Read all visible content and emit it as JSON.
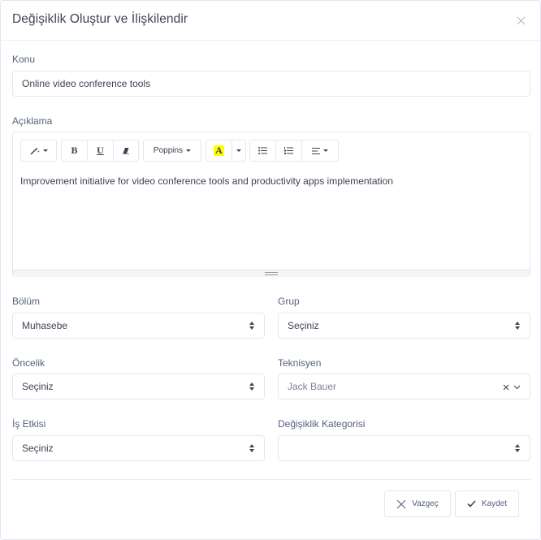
{
  "modal": {
    "title": "Değişiklik Oluştur ve İlişkilendir"
  },
  "fields": {
    "konu": {
      "label": "Konu",
      "value": "Online video conference tools"
    },
    "aciklama": {
      "label": "Açıklama",
      "content": "Improvement initiative for video conference tools and productivity apps implementation"
    },
    "bolum": {
      "label": "Bölüm",
      "value": "Muhasebe"
    },
    "grup": {
      "label": "Grup",
      "value": "Seçiniz"
    },
    "oncelik": {
      "label": "Öncelik",
      "value": "Seçiniz"
    },
    "teknisyen": {
      "label": "Teknisyen",
      "value": "Jack Bauer"
    },
    "is_etkisi": {
      "label": "İş Etkisi",
      "value": "Seçiniz"
    },
    "kategori": {
      "label": "Değişiklik Kategorisi",
      "value": ""
    }
  },
  "toolbar": {
    "bold": "B",
    "underline": "U",
    "font_name": "Poppins",
    "color_letter": "A",
    "highlight_color": "#ffff00"
  },
  "buttons": {
    "cancel": "Vazgeç",
    "save": "Kaydet"
  }
}
